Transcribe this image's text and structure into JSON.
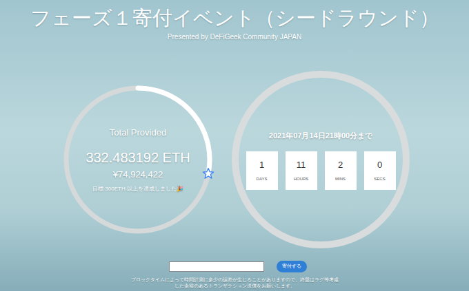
{
  "header": {
    "title": "フェーズ１寄付イベント（シードラウンド）",
    "subtitle": "Presented by DeFiGeek Community JAPAN"
  },
  "provided": {
    "label": "Total Provided",
    "amount": "332.483192 ETH",
    "yen": "¥74,924,422",
    "goal_note": "目標 300ETH 以上を達成しました🎉",
    "level": 0.28
  },
  "countdown": {
    "deadline": "2021年07月14日21時00分まで",
    "units": [
      {
        "value": "1",
        "label": "DAYS"
      },
      {
        "value": "11",
        "label": "HOURS"
      },
      {
        "value": "2",
        "label": "MINS"
      },
      {
        "value": "0",
        "label": "SECS"
      }
    ]
  },
  "donate": {
    "input_value": "",
    "button": "寄付する"
  },
  "note": [
    "ブロックタイムによって時間計測に多少の誤差が生じることがありますので、終盤はラグ等考慮",
    "した余裕のあるトランザクション送信をお願いします。"
  ]
}
